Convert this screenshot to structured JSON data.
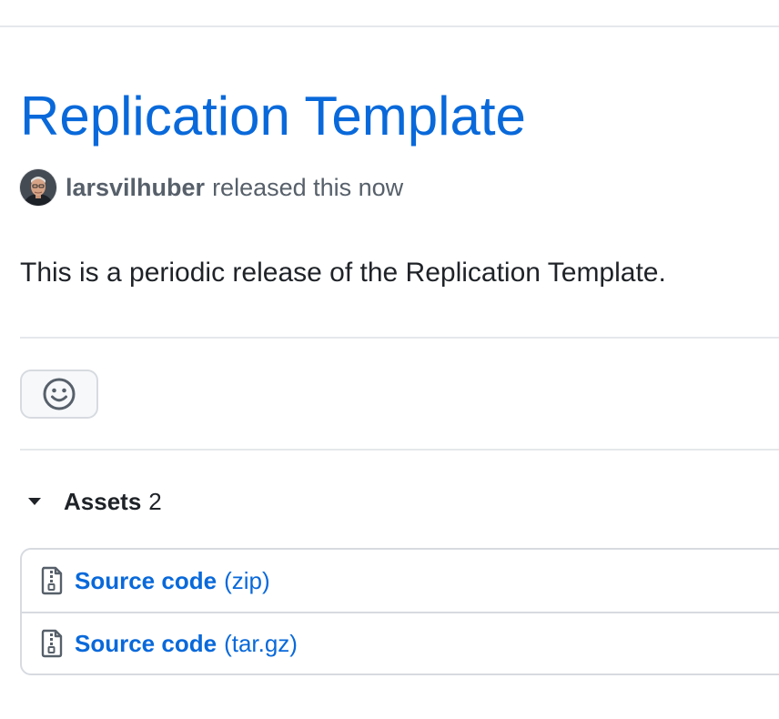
{
  "release": {
    "title": "Replication Template",
    "author": "larsvilhuber",
    "released_text": "released this now",
    "body": "This is a periodic release of the Replication Template."
  },
  "reactions": {
    "button_icon": "smiley-icon"
  },
  "assets": {
    "label": "Assets",
    "count": "2",
    "items": [
      {
        "label": "Source code",
        "kind": "(zip)",
        "icon": "file-zip-icon"
      },
      {
        "label": "Source code",
        "kind": "(tar.gz)",
        "icon": "file-zip-icon"
      }
    ]
  },
  "colors": {
    "link": "#0969da",
    "muted_text": "#57606a",
    "border": "#d7dbe0",
    "button_bg": "#f6f8fa"
  }
}
